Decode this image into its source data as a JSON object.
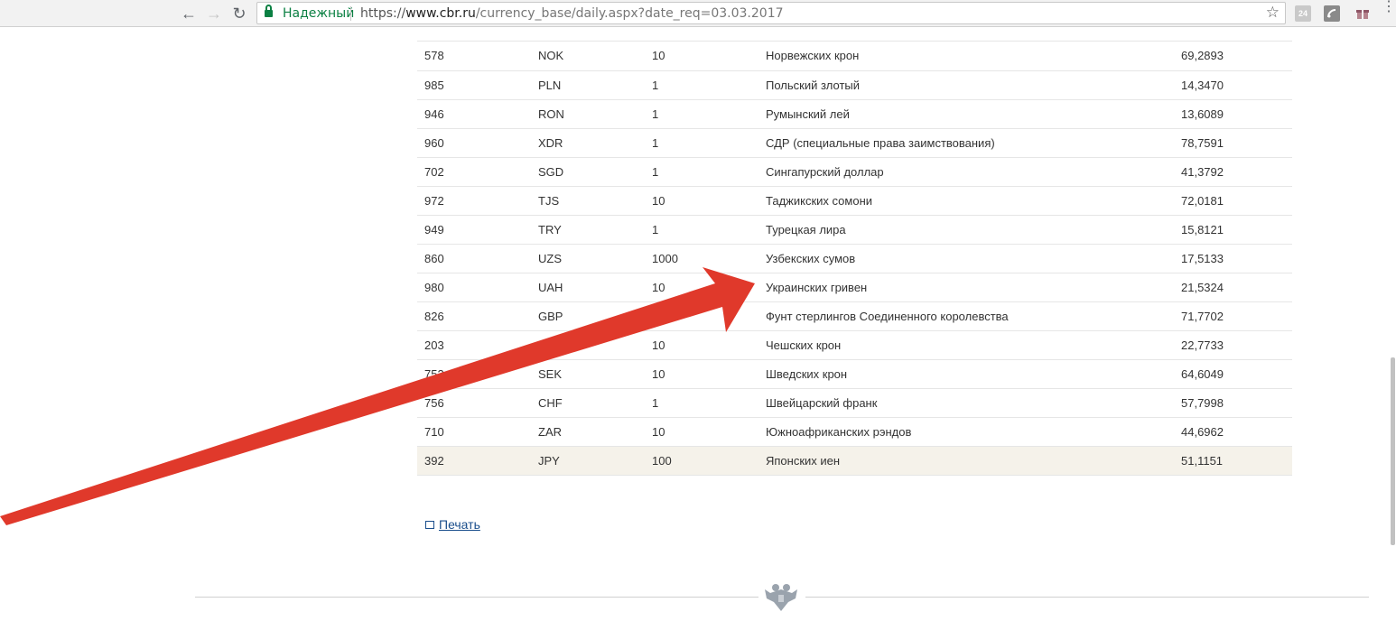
{
  "browser": {
    "secure_label": "Надежный",
    "url_scheme": "https://",
    "url_host": "www.cbr.ru",
    "url_path": "/currency_base/daily.aspx?date_req=03.03.2017",
    "extension_badge": "24"
  },
  "rates": [
    {
      "code": "578",
      "letter": "NOK",
      "units": "10",
      "name": "Норвежских крон",
      "rate": "69,2893"
    },
    {
      "code": "985",
      "letter": "PLN",
      "units": "1",
      "name": "Польский злотый",
      "rate": "14,3470"
    },
    {
      "code": "946",
      "letter": "RON",
      "units": "1",
      "name": "Румынский лей",
      "rate": "13,6089"
    },
    {
      "code": "960",
      "letter": "XDR",
      "units": "1",
      "name": "СДР (специальные права заимствования)",
      "rate": "78,7591"
    },
    {
      "code": "702",
      "letter": "SGD",
      "units": "1",
      "name": "Сингапурский доллар",
      "rate": "41,3792"
    },
    {
      "code": "972",
      "letter": "TJS",
      "units": "10",
      "name": "Таджикских сомони",
      "rate": "72,0181"
    },
    {
      "code": "949",
      "letter": "TRY",
      "units": "1",
      "name": "Турецкая лира",
      "rate": "15,8121"
    },
    {
      "code": "860",
      "letter": "UZS",
      "units": "1000",
      "name": "Узбекских сумов",
      "rate": "17,5133"
    },
    {
      "code": "980",
      "letter": "UAH",
      "units": "10",
      "name": "Украинских гривен",
      "rate": "21,5324"
    },
    {
      "code": "826",
      "letter": "GBP",
      "units": "",
      "name": "Фунт стерлингов Соединенного королевства",
      "rate": "71,7702"
    },
    {
      "code": "203",
      "letter": "",
      "units": "10",
      "name": "Чешских крон",
      "rate": "22,7733"
    },
    {
      "code": "752",
      "letter": "SEK",
      "units": "10",
      "name": "Шведских крон",
      "rate": "64,6049"
    },
    {
      "code": "756",
      "letter": "CHF",
      "units": "1",
      "name": "Швейцарский франк",
      "rate": "57,7998"
    },
    {
      "code": "710",
      "letter": "ZAR",
      "units": "10",
      "name": "Южноафриканских рэндов",
      "rate": "44,6962"
    },
    {
      "code": "392",
      "letter": "JPY",
      "units": "100",
      "name": "Японских иен",
      "rate": "51,1151"
    }
  ],
  "print_label": "Печать",
  "colors": {
    "arrow": "#e0392b",
    "highlight_row": "#f5f2ea",
    "secure_green": "#0b8043",
    "link_blue": "#1a4e8c"
  }
}
